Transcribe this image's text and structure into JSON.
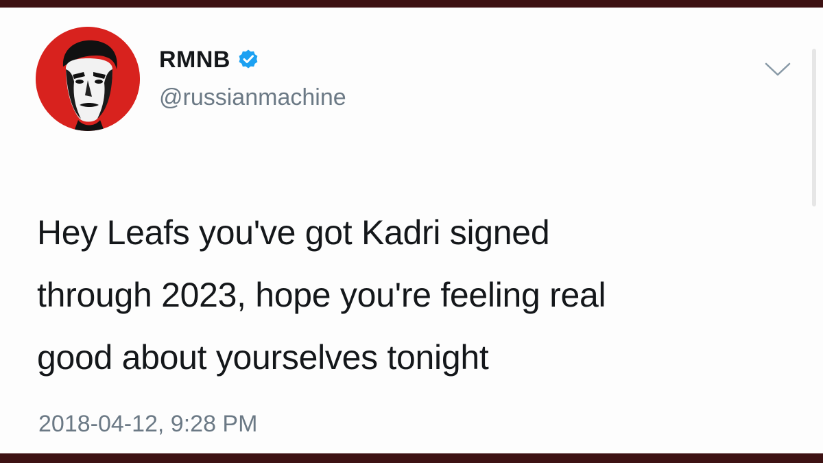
{
  "account": {
    "display_name": "RMNB",
    "handle": "@russianmachine",
    "verified": true,
    "avatar_icon": "avatar-face-icon",
    "avatar_color": "#d8221e"
  },
  "tweet": {
    "lines": [
      "Hey Leafs you've got Kadri signed",
      "through 2023, hope you're feeling real",
      "good about yourselves tonight"
    ],
    "timestamp": "2018-04-12, 9:28 PM"
  },
  "icons": {
    "verified": "verified-badge-icon",
    "menu": "chevron-down-icon"
  },
  "colors": {
    "verified_blue": "#1da1f2",
    "text": "#14171a",
    "secondary_text": "#6b7985",
    "frame": "#3d1213"
  }
}
